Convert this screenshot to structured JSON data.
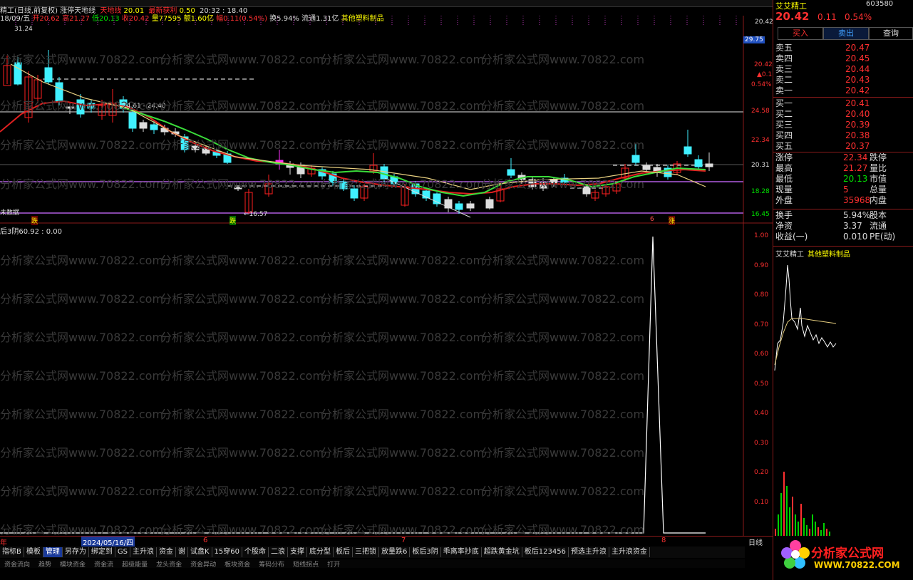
{
  "header": {
    "name_fragment": "精工(日线,前复权)",
    "indicator_name": "涨停天地线",
    "tian_di": "天地线",
    "tian_di_val": "20.01",
    "profit_label": "最新获利",
    "profit_val": "0.50",
    "time_text": "20:32 : 18.40"
  },
  "stockinfo": {
    "date": "18/09/五",
    "open": "开20.62",
    "high": "高21.27",
    "low": "低20.13",
    "close": "收20.42",
    "vol": "量77595",
    "amount": "额1.60亿",
    "change": "幅0.11(0.54%)",
    "turnover": "换5.94%",
    "float": "流通1.31亿",
    "sector": "其他塑料制品"
  },
  "main_chart": {
    "price_left_high": "31.24",
    "range_label": "24.61 - 24.40",
    "low_label": "16.57",
    "left_label": "未数据",
    "markers": [
      "跌",
      "跌",
      "6",
      "涨"
    ],
    "y_labels": [
      "20.42",
      "29.75",
      "24.58",
      "22.34",
      "20.31",
      "18.28",
      "16.45"
    ],
    "current_price_tag": "29.75",
    "right_small": [
      "20.42",
      "▲0.11",
      "0.54%"
    ],
    "watermark": "分析家公式网www.70822.com"
  },
  "indicator": {
    "title": "后3阴60.92 : 0.00",
    "y_labels": [
      "1.00",
      "0.90",
      "0.80",
      "0.70",
      "0.60",
      "0.50",
      "0.40",
      "0.30",
      "0.20",
      "0.10"
    ]
  },
  "date_axis": {
    "labels": [
      "年",
      "2024/05/16/四",
      "6",
      "7",
      "8"
    ],
    "period": "日线"
  },
  "bottom_tabs": [
    "指标B",
    "模板",
    "管理",
    "另存为",
    "绑定到",
    "GS",
    "主升浪",
    "资金",
    "谢",
    "试盘K",
    "15穿60",
    "个股命",
    "二浪",
    "支撑",
    "底分型",
    "板后",
    "三把锁",
    "放量跌6",
    "板后3阴",
    "乖离率抄底",
    "超跌黄金坑",
    "板后123456",
    "预选主升浪",
    "主升浪资金"
  ],
  "bottom_tabs2": [
    "资金流向",
    "趋势",
    "模块资金",
    "资金流",
    "超级能量",
    "龙头资金",
    "资金异动",
    "板块资金",
    "筹码分布",
    "短线拐点",
    "打开"
  ],
  "right_panel": {
    "name": "艾艾精工",
    "code": "603580",
    "price": "20.42",
    "change": "0.11",
    "pct": "0.54%",
    "buy_btn": "买入",
    "sell_btn": "卖出",
    "query_btn": "查询",
    "sell_rows": [
      {
        "label": "卖五",
        "price": "20.47"
      },
      {
        "label": "卖四",
        "price": "20.45"
      },
      {
        "label": "卖三",
        "price": "20.44"
      },
      {
        "label": "卖二",
        "price": "20.43"
      },
      {
        "label": "卖一",
        "price": "20.42"
      }
    ],
    "buy_rows": [
      {
        "label": "买一",
        "price": "20.41"
      },
      {
        "label": "买二",
        "price": "20.40"
      },
      {
        "label": "买三",
        "price": "20.39"
      },
      {
        "label": "买四",
        "price": "20.38"
      },
      {
        "label": "买五",
        "price": "20.37"
      }
    ],
    "stats": [
      {
        "l": "涨停",
        "v": "22.34",
        "r": "跌停"
      },
      {
        "l": "最高",
        "v": "21.27",
        "r": "量比"
      },
      {
        "l": "最低",
        "v": "20.13",
        "r": "市值"
      },
      {
        "l": "现量",
        "v": "5",
        "r": "总量"
      },
      {
        "l": "外盘",
        "v": "35968",
        "r": "内盘"
      }
    ],
    "stats2": [
      {
        "l": "换手",
        "v": "5.94%",
        "r": "股本"
      },
      {
        "l": "净资",
        "v": "3.37",
        "r": "流通"
      },
      {
        "l": "收益(一)",
        "v": "0.010",
        "r": "PE(动)"
      }
    ],
    "mini_title": "艾艾精工",
    "mini_sector": "其他塑料制品"
  },
  "logo": {
    "line1": "分析家公式网",
    "line2": "WWW.70822.COM"
  }
}
